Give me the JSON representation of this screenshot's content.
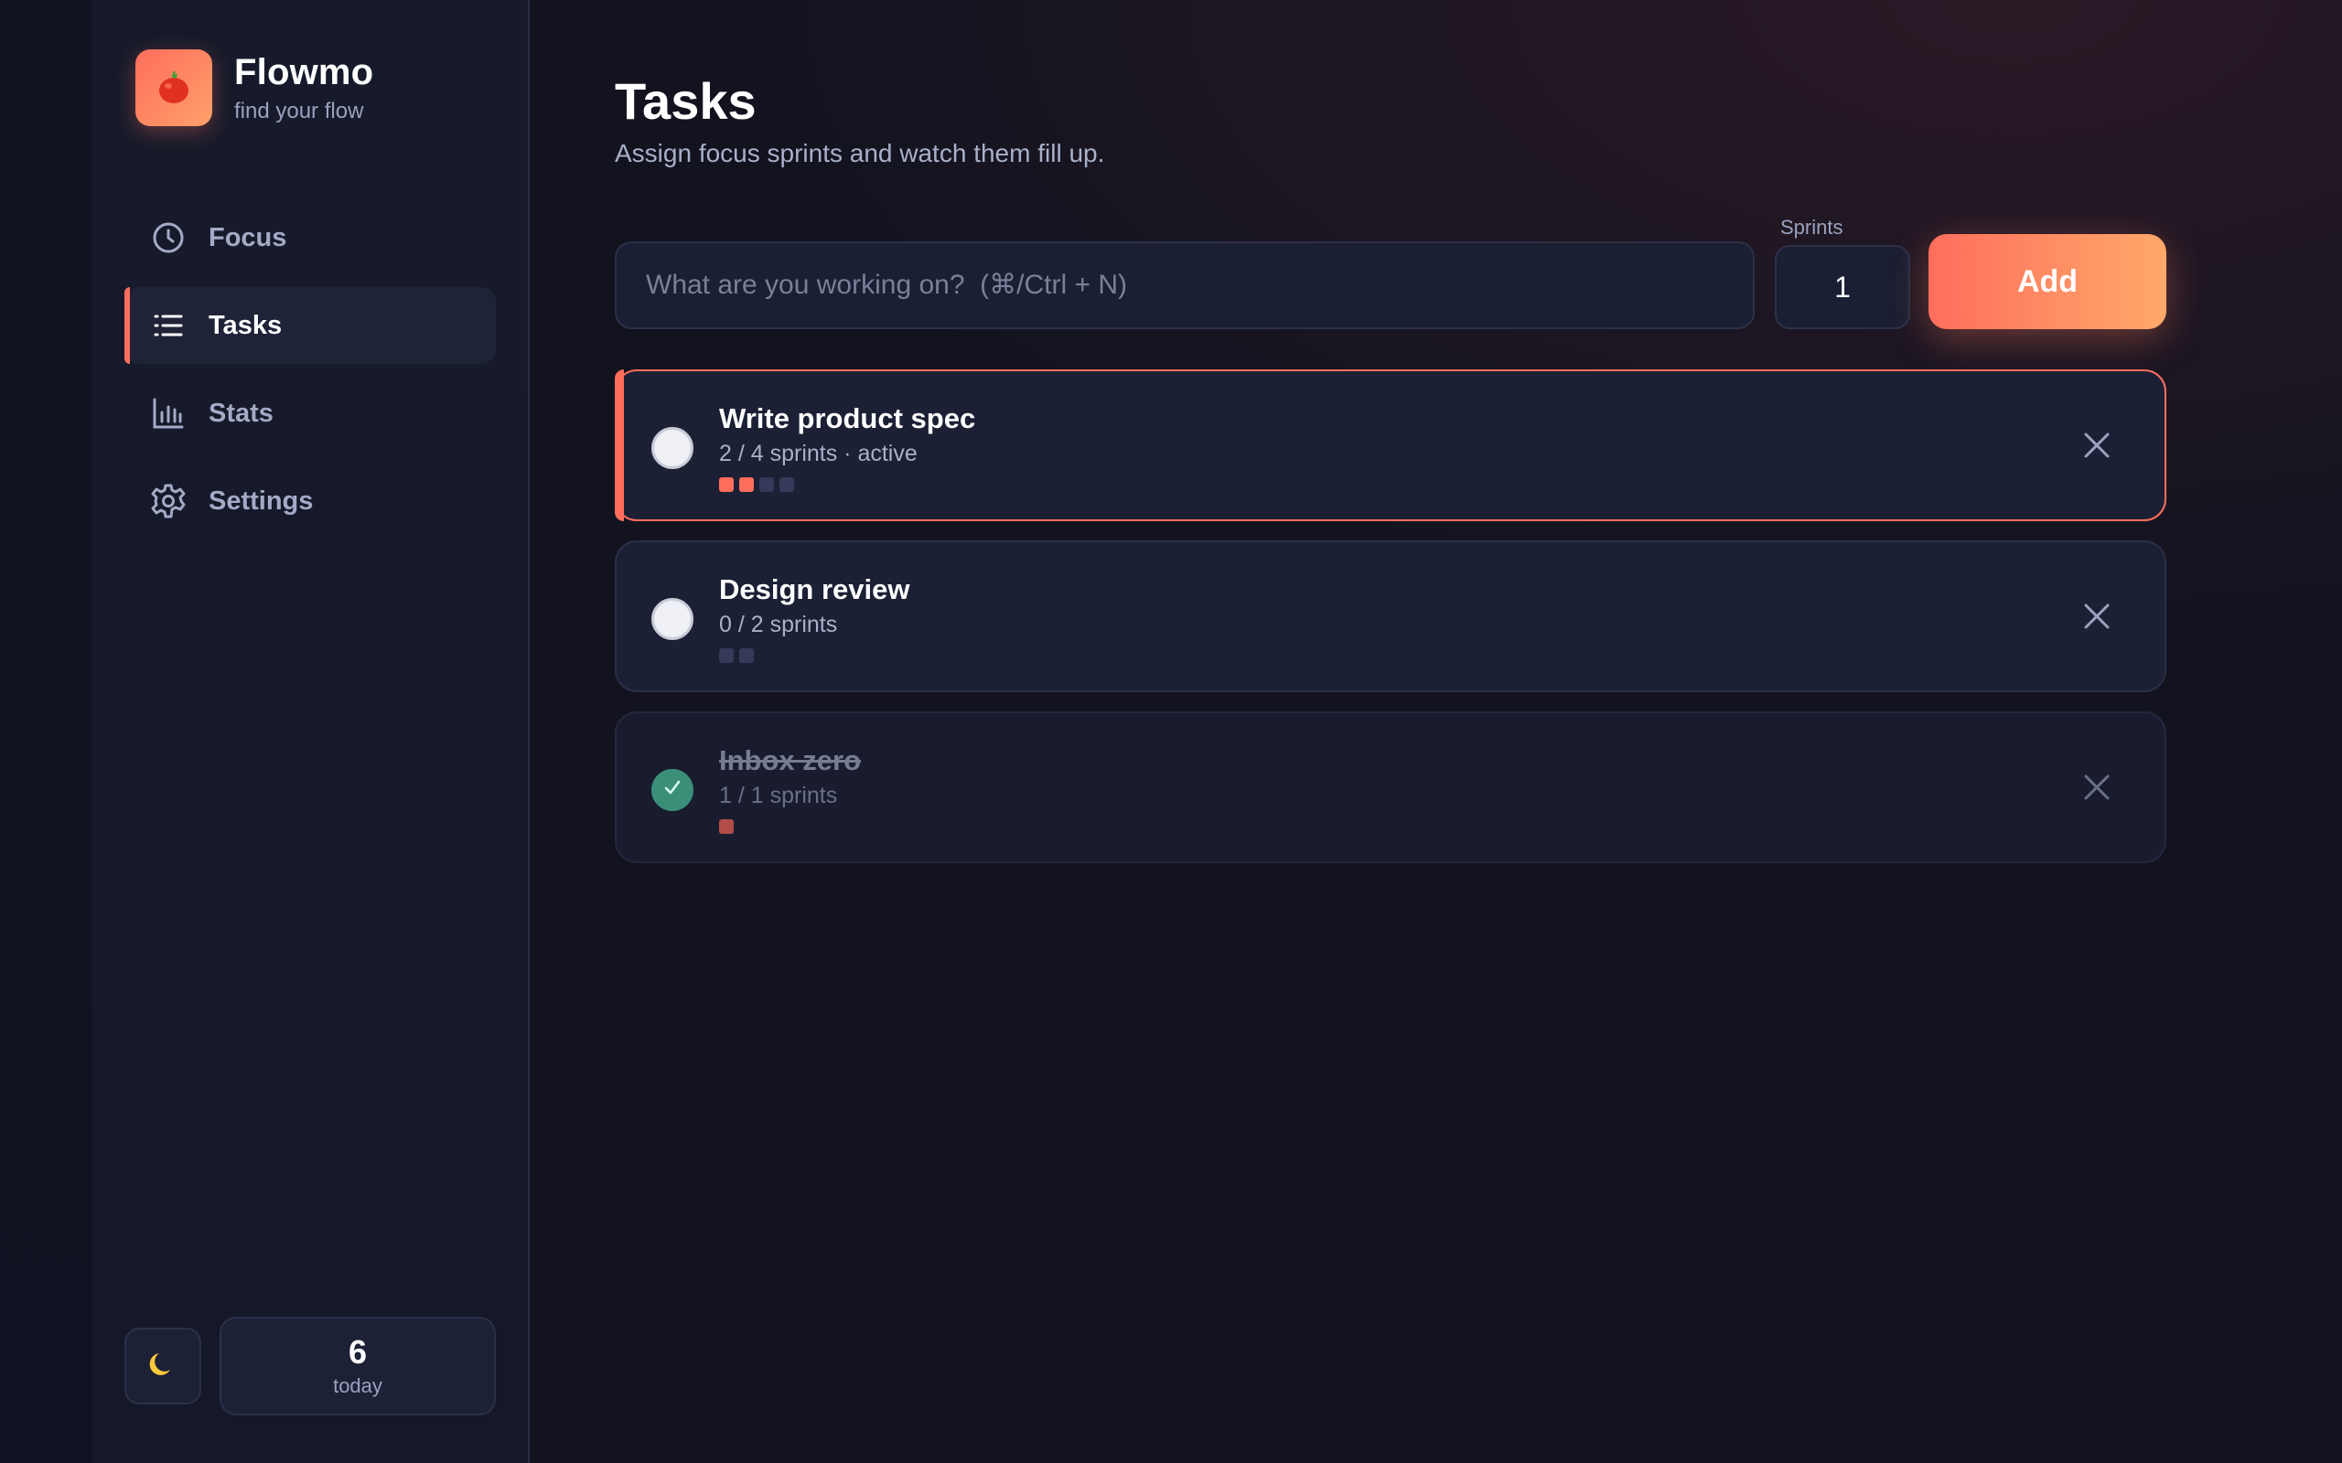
{
  "app": {
    "name": "Flowmo",
    "tagline": "find your flow",
    "logo_icon": "tomato-icon"
  },
  "nav": {
    "items": [
      {
        "label": "Focus",
        "icon": "clock-icon",
        "active": false
      },
      {
        "label": "Tasks",
        "icon": "list-icon",
        "active": true
      },
      {
        "label": "Stats",
        "icon": "bar-chart-icon",
        "active": false
      },
      {
        "label": "Settings",
        "icon": "gear-icon",
        "active": false
      }
    ]
  },
  "footer": {
    "theme_icon": "moon-icon",
    "today_count": "6",
    "today_label": "today"
  },
  "page": {
    "title": "Tasks",
    "subtitle": "Assign focus sprints and watch them fill up."
  },
  "add_form": {
    "placeholder": "What are you working on?  (⌘/Ctrl + N)",
    "sprints_label": "Sprints",
    "sprints_value": "1",
    "add_label": "Add"
  },
  "tasks": [
    {
      "title": "Write product spec",
      "meta": "2 / 4 sprints · active",
      "done": 2,
      "total": 4,
      "completed": false,
      "active": true
    },
    {
      "title": "Design review",
      "meta": "0 / 2 sprints",
      "done": 0,
      "total": 2,
      "completed": false,
      "active": false
    },
    {
      "title": "Inbox zero",
      "meta": "1 / 1 sprints",
      "done": 1,
      "total": 1,
      "completed": true,
      "active": false
    }
  ],
  "colors": {
    "accent": "#ff6e5c",
    "accent_end": "#ffa96a",
    "background": "#12131f",
    "card": "#1c2035",
    "success": "#3b8f78"
  }
}
